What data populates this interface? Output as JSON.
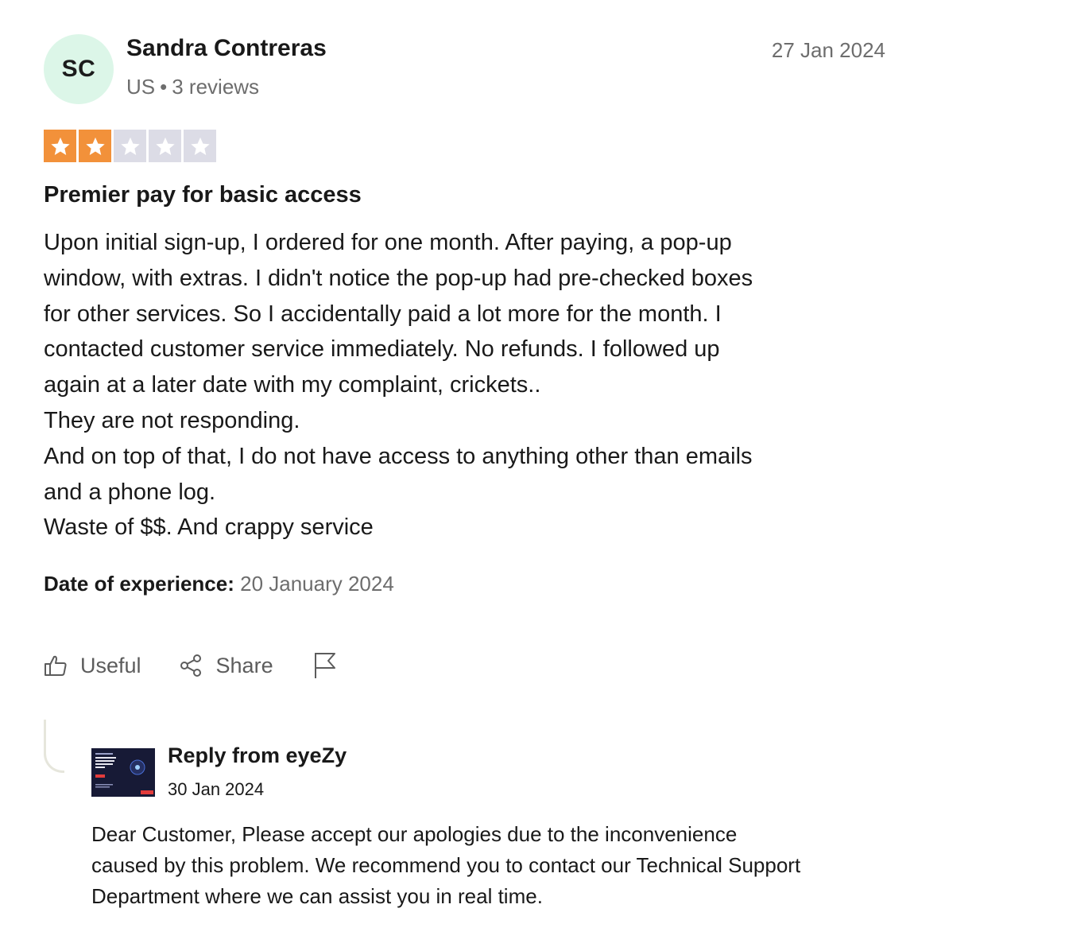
{
  "review": {
    "avatar_initials": "SC",
    "reviewer_name": "Sandra Contreras",
    "country": "US",
    "separator": "•",
    "review_count": "3 reviews",
    "date": "27 Jan 2024",
    "rating": 2,
    "max_rating": 5,
    "star_filled_color": "#f2913a",
    "star_empty_color": "#dcdce6",
    "title": "Premier pay for basic access",
    "body_lines": [
      "Upon initial sign-up, I ordered for one month. After paying, a pop-up",
      "window, with extras. I didn't notice the pop-up had pre-checked boxes",
      "for other services. So I accidentally paid a lot more for the month. I",
      "contacted customer service immediately. No refunds. I followed up",
      "again at a later date with my complaint, crickets..",
      "They are not responding.",
      "And on top of that, I do not have access to anything other than emails",
      "and a phone log.",
      "Waste of $$. And crappy service"
    ],
    "experience_label": "Date of experience:",
    "experience_date": "20 January 2024"
  },
  "actions": {
    "useful_label": "Useful",
    "useful_icon": "thumbs-up-icon",
    "share_label": "Share",
    "share_icon": "share-icon",
    "report_icon": "flag-icon"
  },
  "reply": {
    "title": "Reply from eyeZy",
    "date": "30 Jan 2024",
    "logo_icon": "company-logo",
    "text_lines": [
      "Dear Customer, Please accept our apologies due to the inconvenience",
      "caused by this problem. We recommend you to contact our Technical Support",
      "Department where we can assist you in real time."
    ]
  }
}
